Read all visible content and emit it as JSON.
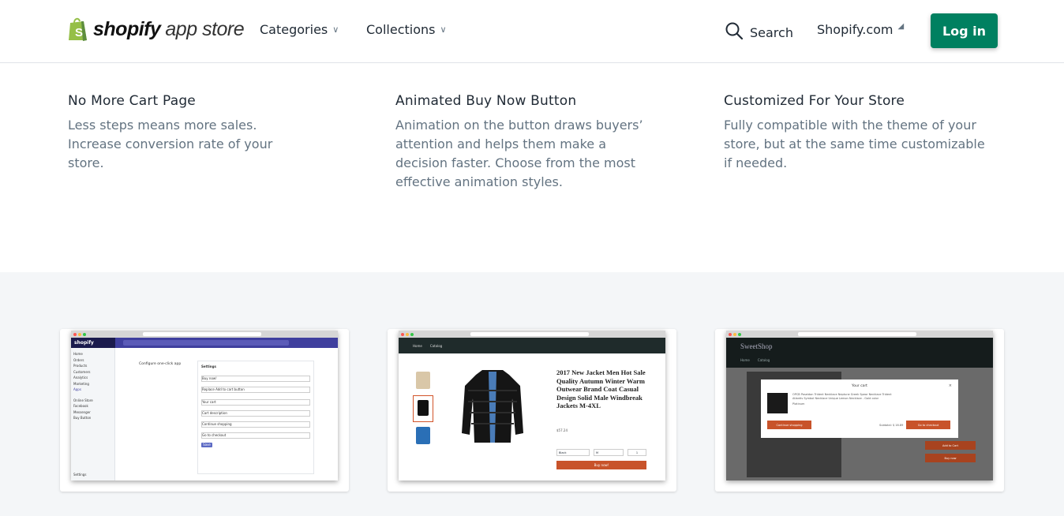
{
  "header": {
    "logo_brand": "shopify",
    "logo_suffix": "app store",
    "nav": [
      {
        "label": "Categories"
      },
      {
        "label": "Collections"
      }
    ],
    "search_label": "Search",
    "shopify_com_label": "Shopify.com",
    "login_label": "Log in"
  },
  "features": [
    {
      "title": "No More Cart Page",
      "text": "Less steps means more sales. Increase conversion rate of your store."
    },
    {
      "title": "Animated Buy Now Button",
      "text": "Animation on the button draws buyers’ attention and helps them make a decision faster. Choose from the most effective animation styles."
    },
    {
      "title": "Customized For Your Store",
      "text": "Fully compatible with the theme of your store, but at the same time customizable if needed."
    }
  ],
  "screenshots": {
    "admin": {
      "settings_title": "Settings",
      "heading": "Configure one-click app",
      "button": "Save",
      "sidebar": [
        "Home",
        "Orders",
        "Products",
        "Customers",
        "Analytics",
        "Marketing",
        "Apps"
      ],
      "sales_channels": [
        "Online Store",
        "Facebook",
        "Messenger",
        "Buy Button"
      ],
      "fields": [
        "Buy now!",
        "Replace Add to cart button",
        "Your cart",
        "Cart description",
        "Continue shopping",
        "Go to checkout"
      ],
      "footer": "Settings"
    },
    "product": {
      "nav": [
        "Home",
        "Catalog"
      ],
      "title": "2017 New Jacket Men Hot Sale Quality Autumn Winter Warm Outwear Brand Coat Casual Design Solid Male Windbreak Jackets M-4XL",
      "price": "$57.24",
      "color_value": "Black",
      "size_value": "M",
      "qty_value": "1",
      "buy_label": "Buy now!"
    },
    "cart": {
      "store_name": "SweetShop",
      "nav": [
        "Home",
        "Catalog"
      ],
      "modal_title": "Your cart",
      "item_text": "OPCB Poseidon Trident Necklace Neptune Greek Spear Necklace Trident Atlantis Symbol Necklace Unique Lemon Necklace - Gold color",
      "item_variant": "Platinum",
      "continue_label": "Continue shopping",
      "checkout_label": "Go to checkout",
      "subtotal": "Subtotal: $ 16.89",
      "add_cart": "Add to Cart",
      "buy_now": "Buy now"
    }
  },
  "colors": {
    "primary": "#008060",
    "accent_orange": "#c8532a",
    "admin_nav": "#3f3f9e"
  }
}
